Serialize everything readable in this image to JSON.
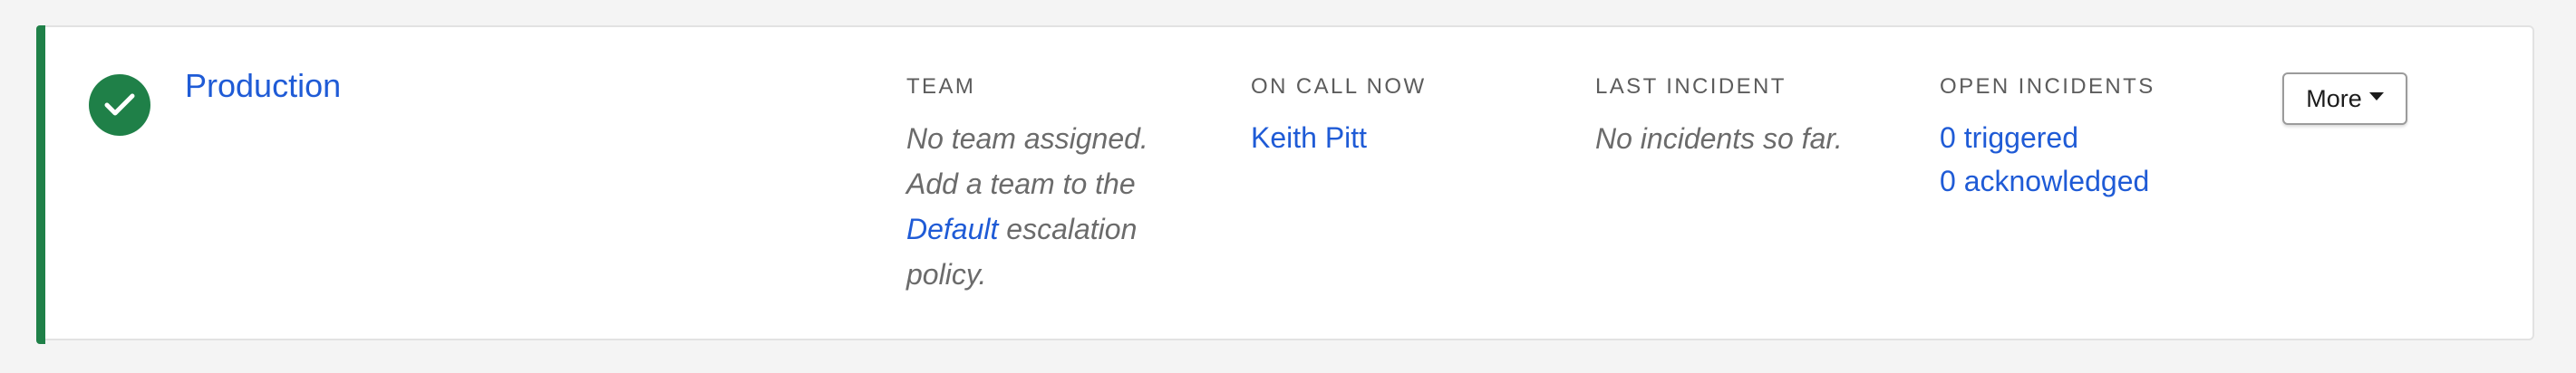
{
  "service": {
    "name": "Production",
    "status_color": "#1f8048",
    "status_icon": "check-icon"
  },
  "columns": {
    "team": {
      "label": "TEAM",
      "text_before": "No team assigned. Add a team to the ",
      "link": "Default",
      "text_after": " escalation policy."
    },
    "on_call": {
      "label": "ON CALL NOW",
      "person": "Keith Pitt"
    },
    "last_incident": {
      "label": "LAST INCIDENT",
      "value": "No incidents so far."
    },
    "open_incidents": {
      "label": "OPEN INCIDENTS",
      "triggered": "0 triggered",
      "acknowledged": "0 acknowledged"
    }
  },
  "actions": {
    "more_label": "More"
  },
  "colors": {
    "link": "#1f5bd6",
    "accent": "#1f8048"
  }
}
